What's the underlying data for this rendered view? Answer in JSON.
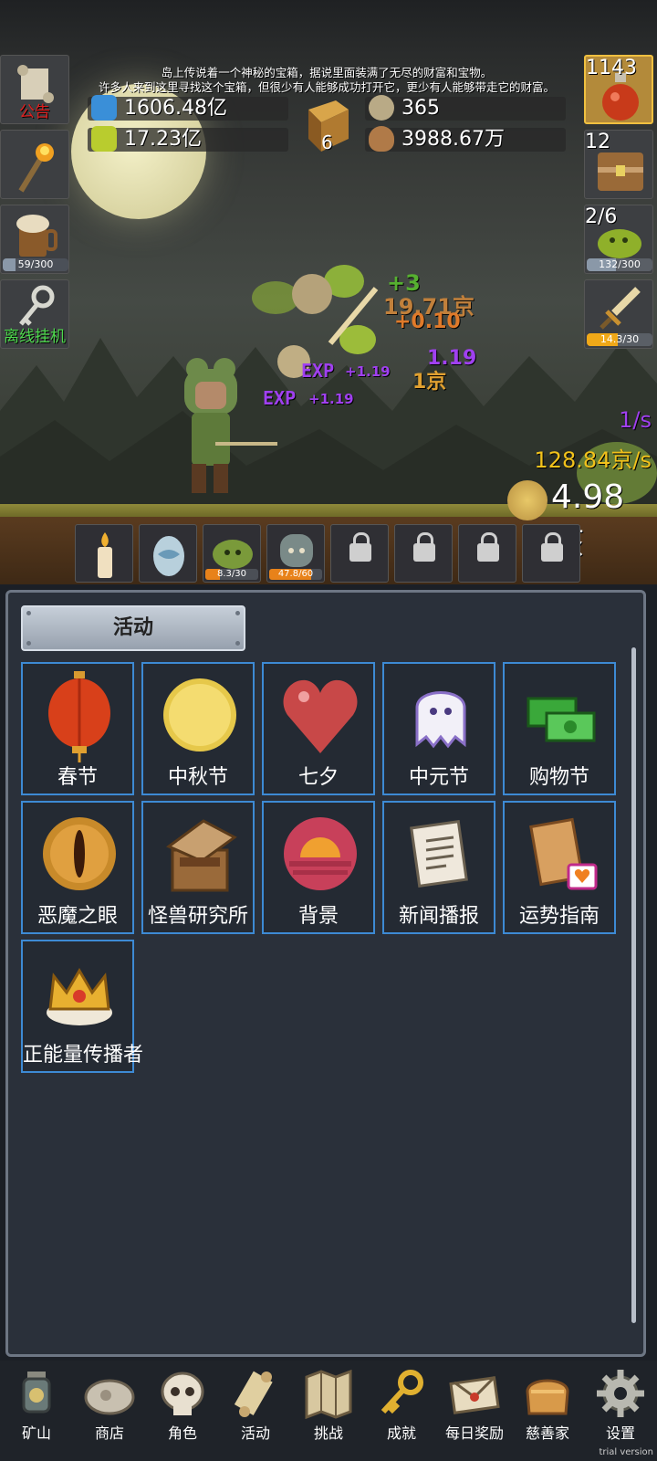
{
  "notice": {
    "line1": "岛上传说着一个神秘的宝箱，据说里面装满了无尽的财富和宝物。",
    "line2": "许多人来到这里寻找这个宝箱，但很少有人能够成功打开它，更少有人能够带走它的财富。"
  },
  "resources": {
    "blue_potion": "1606.48亿",
    "green_potion": "17.23亿",
    "book_count": "6",
    "coin_small": "365",
    "seed": "3988.67万"
  },
  "left_buttons": {
    "announcement": "公告",
    "mug_progress": "59/300",
    "mug_fill": 0.197,
    "offline": "离线挂机"
  },
  "right_buttons": {
    "potion_count": "1143",
    "chest_count": "12",
    "slime_count": "2/6",
    "slime_progress": "132/300",
    "slime_fill": 0.44,
    "sword_progress": "14.3/30",
    "sword_fill": 0.477
  },
  "scene": {
    "float_plus3": "+3",
    "float_gold1": "19.71京",
    "float_plus010": "+0.10",
    "float_exp1": "EXP",
    "float_exp2": "EXP",
    "float_exp_val1": "+1.19",
    "float_exp_val2": "+1.19",
    "float_exp_val3": "1.19",
    "float_gold2": "1京",
    "rate_exp": "1/s",
    "rate_gold": "128.84京/s",
    "gold_total": "4.98垓"
  },
  "slots": [
    {
      "name": "candle"
    },
    {
      "name": "egg"
    },
    {
      "name": "slime",
      "progress": "8.3/30",
      "fill": 0.277
    },
    {
      "name": "zombie",
      "progress": "47.8/60",
      "fill": 0.797
    },
    {
      "name": "locked"
    },
    {
      "name": "locked"
    },
    {
      "name": "locked"
    },
    {
      "name": "locked"
    }
  ],
  "panel": {
    "title": "活动",
    "tiles": [
      "春节",
      "中秋节",
      "七夕",
      "中元节",
      "购物节",
      "恶魔之眼",
      "怪兽研究所",
      "背景",
      "新闻播报",
      "运势指南",
      "正能量传播者"
    ]
  },
  "nav": [
    "矿山",
    "商店",
    "角色",
    "活动",
    "挑战",
    "成就",
    "每日奖励",
    "慈善家",
    "设置"
  ],
  "trial": "trial version",
  "colors": {
    "tile_border": "#3d8ad4",
    "progress_orange": "#f0a818",
    "gold_text": "#f2c21b",
    "exp_purple": "#a040f0"
  }
}
